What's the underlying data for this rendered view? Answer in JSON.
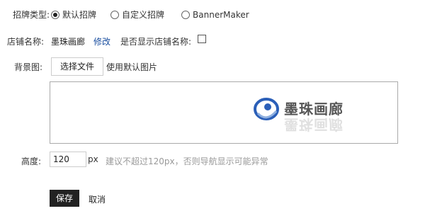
{
  "banner_type": {
    "label": "招牌类型:",
    "options": [
      {
        "label": "默认招牌",
        "selected": true
      },
      {
        "label": "自定义招牌",
        "selected": false
      },
      {
        "label": "BannerMaker",
        "selected": false
      }
    ]
  },
  "shop_name": {
    "label": "店铺名称:",
    "value": "墨珠画廊",
    "edit_link": "修改",
    "show_label": "是否显示店铺名称:",
    "show_checked": false
  },
  "background": {
    "label": "背景图:",
    "choose_button": "选择文件",
    "status": "使用默认图片",
    "logo_text": "墨珠画廊",
    "logo_reflection": "墨珠画廊"
  },
  "height": {
    "label": "高度:",
    "value": "120",
    "unit": "px",
    "hint": "建议不超过120px，否则导航显示可能异常"
  },
  "actions": {
    "save": "保存",
    "cancel": "取消"
  },
  "colors": {
    "link": "#1a4fa0",
    "save_bg": "#222222",
    "logo_blue": "#2b5fb8"
  }
}
